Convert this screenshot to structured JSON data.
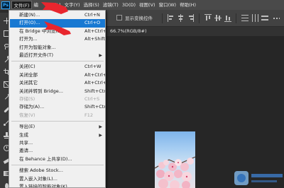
{
  "logo": {
    "text": "Ps",
    "color": "#31a8ff"
  },
  "menubar": {
    "items": [
      {
        "label": "文件(F)",
        "active": true
      },
      {
        "label": "编",
        "active": false
      },
      {
        "label": "",
        "active": false
      },
      {
        "label": "图层(L)",
        "active": false
      },
      {
        "label": "文字(Y)",
        "active": false
      },
      {
        "label": "选择(S)",
        "active": false
      },
      {
        "label": "滤镜(T)",
        "active": false
      },
      {
        "label": "3D(D)",
        "active": false
      },
      {
        "label": "视图(V)",
        "active": false
      },
      {
        "label": "窗口(W)",
        "active": false
      },
      {
        "label": "帮助(H)",
        "active": false
      }
    ]
  },
  "options_bar": {
    "show_transform_controls": "显示变换控件"
  },
  "document_tab": {
    "title": "66.7%(RGB/8#)"
  },
  "file_menu": {
    "items": [
      {
        "label": "新建(N)...",
        "shortcut": "Ctrl+N",
        "disabled": false,
        "highlight": false,
        "submenu": false
      },
      {
        "label": "打开(O)...",
        "shortcut": "Ctrl+O",
        "disabled": false,
        "highlight": true,
        "submenu": false
      },
      {
        "label": "在 Bridge 中浏览(B)...",
        "shortcut": "Alt+Ctrl+O",
        "disabled": false,
        "highlight": false,
        "submenu": false
      },
      {
        "label": "打开为...",
        "shortcut": "Alt+Shift+Ctrl+O",
        "disabled": false,
        "highlight": false,
        "submenu": false
      },
      {
        "label": "打开为智能对象...",
        "shortcut": "",
        "disabled": false,
        "highlight": false,
        "submenu": false
      },
      {
        "label": "最近打开文件(T)",
        "shortcut": "",
        "disabled": false,
        "highlight": false,
        "submenu": true
      },
      {
        "sep": true
      },
      {
        "label": "关闭(C)",
        "shortcut": "Ctrl+W",
        "disabled": false,
        "highlight": false,
        "submenu": false
      },
      {
        "label": "关闭全部",
        "shortcut": "Alt+Ctrl+W",
        "disabled": false,
        "highlight": false,
        "submenu": false
      },
      {
        "label": "关闭其它",
        "shortcut": "Alt+Ctrl+P",
        "disabled": false,
        "highlight": false,
        "submenu": false
      },
      {
        "label": "关闭并转到 Bridge...",
        "shortcut": "Shift+Ctrl+W",
        "disabled": false,
        "highlight": false,
        "submenu": false
      },
      {
        "label": "存储(S)",
        "shortcut": "Ctrl+S",
        "disabled": true,
        "highlight": false,
        "submenu": false
      },
      {
        "label": "存储为(A)...",
        "shortcut": "Shift+Ctrl+S",
        "disabled": false,
        "highlight": false,
        "submenu": false
      },
      {
        "label": "恢复(V)",
        "shortcut": "F12",
        "disabled": true,
        "highlight": false,
        "submenu": false
      },
      {
        "sep": true
      },
      {
        "label": "导出(E)",
        "shortcut": "",
        "disabled": false,
        "highlight": false,
        "submenu": true
      },
      {
        "label": "生成",
        "shortcut": "",
        "disabled": false,
        "highlight": false,
        "submenu": true
      },
      {
        "label": "共享...",
        "shortcut": "",
        "disabled": false,
        "highlight": false,
        "submenu": false
      },
      {
        "label": "邀请...",
        "shortcut": "",
        "disabled": false,
        "highlight": false,
        "submenu": false
      },
      {
        "label": "在 Behance 上共享(D)...",
        "shortcut": "",
        "disabled": false,
        "highlight": false,
        "submenu": false
      },
      {
        "sep": true
      },
      {
        "label": "搜索 Adobe Stock...",
        "shortcut": "",
        "disabled": false,
        "highlight": false,
        "submenu": false
      },
      {
        "label": "置入嵌入对象(L)...",
        "shortcut": "",
        "disabled": false,
        "highlight": false,
        "submenu": false
      },
      {
        "label": "置入链接的智能对象(K)...",
        "shortcut": "",
        "disabled": false,
        "highlight": false,
        "submenu": false
      }
    ]
  },
  "colors": {
    "menu_highlight": "#1979d2",
    "annotation_arrow": "#e8262e",
    "menubar_bg": "#4a4a4a",
    "workspace_bg": "#262626"
  }
}
